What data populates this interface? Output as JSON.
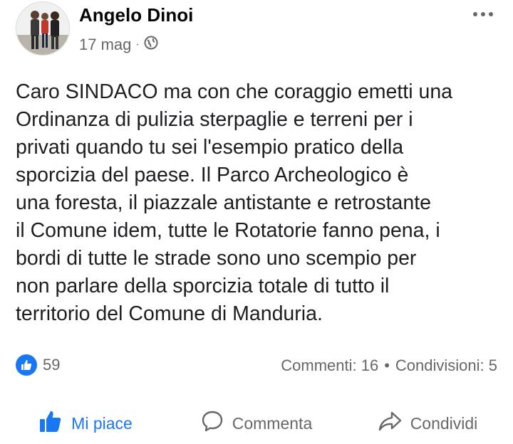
{
  "post": {
    "author": "Angelo Dinoi",
    "date": "17 mag",
    "separator": "·",
    "privacy_icon": "globe-icon",
    "text": "Caro SINDACO ma con che coraggio emetti una\nOrdinanza di pulizia sterpaglie e terreni  per i\nprivati quando tu sei l'esempio pratico della\nsporcizia del paese. Il  Parco Archeologico è\nuna foresta, il piazzale antistante e retrostante\nil Comune idem, tutte le Rotatorie fanno pena, i\nbordi di tutte le strade sono uno scempio per\nnon parlare della sporcizia totale di tutto il\nterritorio del Comune di Manduria."
  },
  "stats": {
    "likes": "59",
    "comments": "Commenti: 16",
    "bullet": "•",
    "shares": "Condivisioni: 5"
  },
  "actions": {
    "like": "Mi piace",
    "comment": "Commenta",
    "share": "Condividi"
  },
  "colors": {
    "accent": "#1877f2",
    "secondary_text": "#65676b"
  }
}
